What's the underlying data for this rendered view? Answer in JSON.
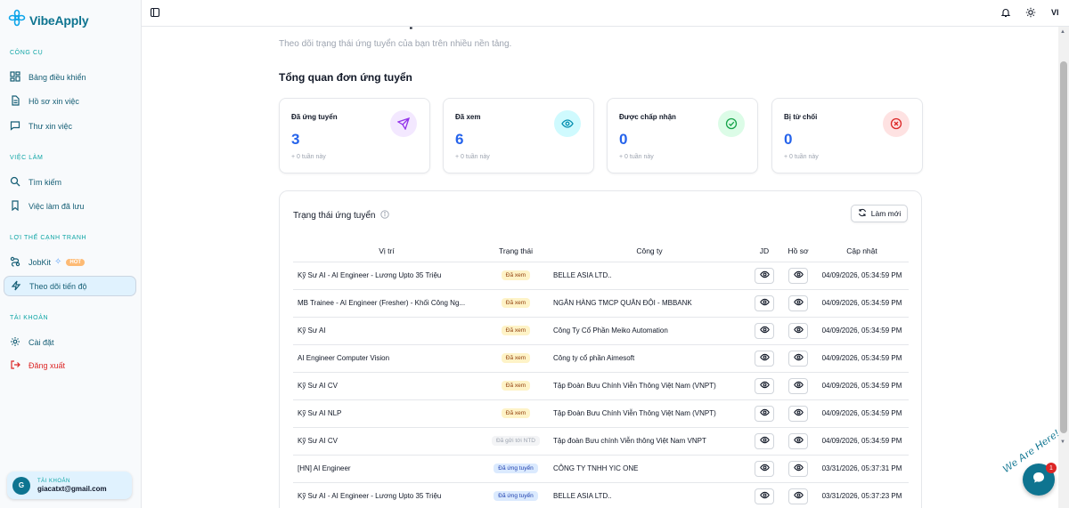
{
  "app": {
    "name": "VibeApply",
    "language": "VI"
  },
  "sidebar": {
    "sections": [
      {
        "label": "Công cụ"
      },
      {
        "label": "Việc làm"
      },
      {
        "label": "Lợi thế cạnh tranh"
      },
      {
        "label": "Tài khoản"
      }
    ],
    "items": [
      {
        "label": "Bảng điều khiển",
        "icon": "dashboard-icon"
      },
      {
        "label": "Hồ sơ xin việc",
        "icon": "document-icon"
      },
      {
        "label": "Thư xin việc",
        "icon": "message-icon"
      },
      {
        "label": "Tìm kiếm",
        "icon": "search-icon"
      },
      {
        "label": "Việc làm đã lưu",
        "icon": "bookmark-icon"
      },
      {
        "label": "JobKit",
        "icon": "route-icon",
        "badge": "HOT"
      },
      {
        "label": "Theo dõi tiến độ",
        "icon": "bolt-icon",
        "active": true
      },
      {
        "label": "Cài đặt",
        "icon": "gear-icon"
      },
      {
        "label": "Đăng xuất",
        "icon": "logout-icon"
      }
    ],
    "account": {
      "label": "Tài khoản",
      "initial": "G",
      "email": "giacatxt@gmail.com"
    }
  },
  "page": {
    "title": "Theo dõi tiến độ",
    "subtitle": "Theo dõi trạng thái ứng tuyển của bạn trên nhiều nền tảng.",
    "overview_title": "Tổng quan đơn ứng tuyển"
  },
  "stats": [
    {
      "label": "Đã ứng tuyển",
      "value": "3",
      "week": "+ 0 tuần này",
      "icon": "send-icon",
      "color": "#9333ea",
      "bg": "#f3e8ff"
    },
    {
      "label": "Đã xem",
      "value": "6",
      "week": "+ 0 tuần này",
      "icon": "eye-icon",
      "color": "#0891b2",
      "bg": "#cffafe"
    },
    {
      "label": "Được chấp nhận",
      "value": "0",
      "week": "+ 0 tuần này",
      "icon": "check-circle-icon",
      "color": "#16a34a",
      "bg": "#dcfce7"
    },
    {
      "label": "Bị từ chối",
      "value": "0",
      "week": "+ 0 tuần này",
      "icon": "x-circle-icon",
      "color": "#dc2626",
      "bg": "#fee2e2"
    }
  ],
  "status_panel": {
    "title": "Trạng thái ứng tuyển",
    "refresh_label": "Làm mới",
    "columns": [
      "Vị trí",
      "Trạng thái",
      "Công ty",
      "JD",
      "Hồ sơ",
      "Cập nhật"
    ],
    "rows": [
      {
        "position": "Kỹ Sư AI - AI Engineer - Lương Upto 35 Triệu",
        "status": "Đã xem",
        "status_type": "seen",
        "company": "BELLE ASIA LTD..",
        "updated": "04/09/2026, 05:34:59 PM"
      },
      {
        "position": "MB Trainee - AI Engineer (Fresher) - Khối Công Ng...",
        "status": "Đã xem",
        "status_type": "seen",
        "company": "NGÂN HÀNG TMCP QUÂN ĐỘI - MBBANK",
        "updated": "04/09/2026, 05:34:59 PM"
      },
      {
        "position": "Kỹ Sư AI",
        "status": "Đã xem",
        "status_type": "seen",
        "company": "Công Ty Cổ Phần Meiko Automation",
        "updated": "04/09/2026, 05:34:59 PM"
      },
      {
        "position": "AI Engineer Computer Vision",
        "status": "Đã xem",
        "status_type": "seen",
        "company": "Công ty cổ phần Aimesoft",
        "updated": "04/09/2026, 05:34:59 PM"
      },
      {
        "position": "Kỹ Sư AI CV",
        "status": "Đã xem",
        "status_type": "seen",
        "company": "Tập Đoàn Bưu Chính Viễn Thông Việt Nam (VNPT)",
        "updated": "04/09/2026, 05:34:59 PM"
      },
      {
        "position": "Kỹ Sư AI NLP",
        "status": "Đã xem",
        "status_type": "seen",
        "company": "Tập Đoàn Bưu Chính Viễn Thông Việt Nam (VNPT)",
        "updated": "04/09/2026, 05:34:59 PM"
      },
      {
        "position": "Kỹ Sư AI CV",
        "status": "Đã gửi tới NTD",
        "status_type": "sent",
        "company": "Tập đoàn Bưu chính Viễn thông Việt Nam VNPT",
        "updated": "04/09/2026, 05:34:59 PM"
      },
      {
        "position": "[HN] AI Engineer",
        "status": "Đã ứng tuyển",
        "status_type": "applied",
        "company": "CÔNG TY TNHH YIC ONE",
        "updated": "03/31/2026, 05:37:31 PM"
      },
      {
        "position": "Kỹ Sư AI - AI Engineer - Lương Upto 35 Triệu",
        "status": "Đã ứng tuyển",
        "status_type": "applied",
        "company": "BELLE ASIA LTD..",
        "updated": "03/31/2026, 05:37:23 PM"
      }
    ]
  },
  "chat": {
    "tag": "We Are Here!",
    "badge": "1"
  }
}
